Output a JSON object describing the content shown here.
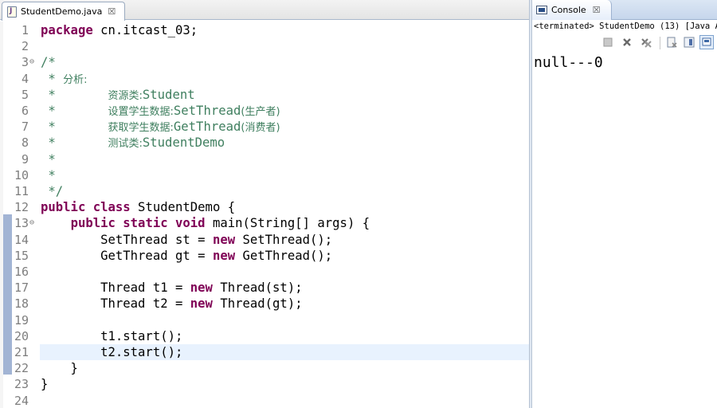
{
  "editor": {
    "tab_title": "StudentDemo.java",
    "tab_close": "☒",
    "lines": [
      {
        "n": "1"
      },
      {
        "n": "2"
      },
      {
        "n": "3"
      },
      {
        "n": "4"
      },
      {
        "n": "5"
      },
      {
        "n": "6"
      },
      {
        "n": "7"
      },
      {
        "n": "8"
      },
      {
        "n": "9"
      },
      {
        "n": "10"
      },
      {
        "n": "11"
      },
      {
        "n": "12"
      },
      {
        "n": "13"
      },
      {
        "n": "14"
      },
      {
        "n": "15"
      },
      {
        "n": "16"
      },
      {
        "n": "17"
      },
      {
        "n": "18"
      },
      {
        "n": "19"
      },
      {
        "n": "20"
      },
      {
        "n": "21"
      },
      {
        "n": "22"
      },
      {
        "n": "23"
      },
      {
        "n": "24"
      }
    ],
    "code": {
      "l1_kw": "package",
      "l1_rest": " cn.itcast_03;",
      "l3": "/*",
      "l4_star": " * ",
      "l4_text": "分析:",
      "l5_star": " *       ",
      "l5_cn": "资源类:",
      "l5_en": "Student",
      "l6_star": " *       ",
      "l6_cn": "设置学生数据:",
      "l6_en": "SetThread",
      "l6_cn2": "(生产者)",
      "l7_star": " *       ",
      "l7_cn": "获取学生数据:",
      "l7_en": "GetThread",
      "l7_cn2": "(消费者)",
      "l8_star": " *       ",
      "l8_cn": "测试类:",
      "l8_en": "StudentDemo",
      "l9": " *",
      "l10": " *",
      "l11": " */",
      "l12_kw": "public class",
      "l12_rest": " StudentDemo {",
      "l13_indent": "    ",
      "l13_kw": "public static void",
      "l13_rest": " main(String[] args) {",
      "l14_a": "        SetThread st = ",
      "l14_kw": "new",
      "l14_b": " SetThread();",
      "l15_a": "        GetThread gt = ",
      "l15_kw": "new",
      "l15_b": " GetThread();",
      "l17_a": "        Thread t1 = ",
      "l17_kw": "new",
      "l17_b": " Thread(st);",
      "l18_a": "        Thread t2 = ",
      "l18_kw": "new",
      "l18_b": " Thread(gt);",
      "l20": "        t1.start();",
      "l21": "        t2.start();",
      "l22": "    }",
      "l23": "}"
    },
    "fold_marker": "⊖",
    "current_line": "21"
  },
  "console": {
    "tab_title": "Console",
    "tab_close": "☒",
    "status": "<terminated> StudentDemo (13) [Java A",
    "output": "null---0"
  },
  "colors": {
    "keyword": "#7f0055",
    "comment": "#3f7f5f",
    "current_line_bg": "#e8f2fe",
    "change_bar": "#a2b4d4"
  }
}
